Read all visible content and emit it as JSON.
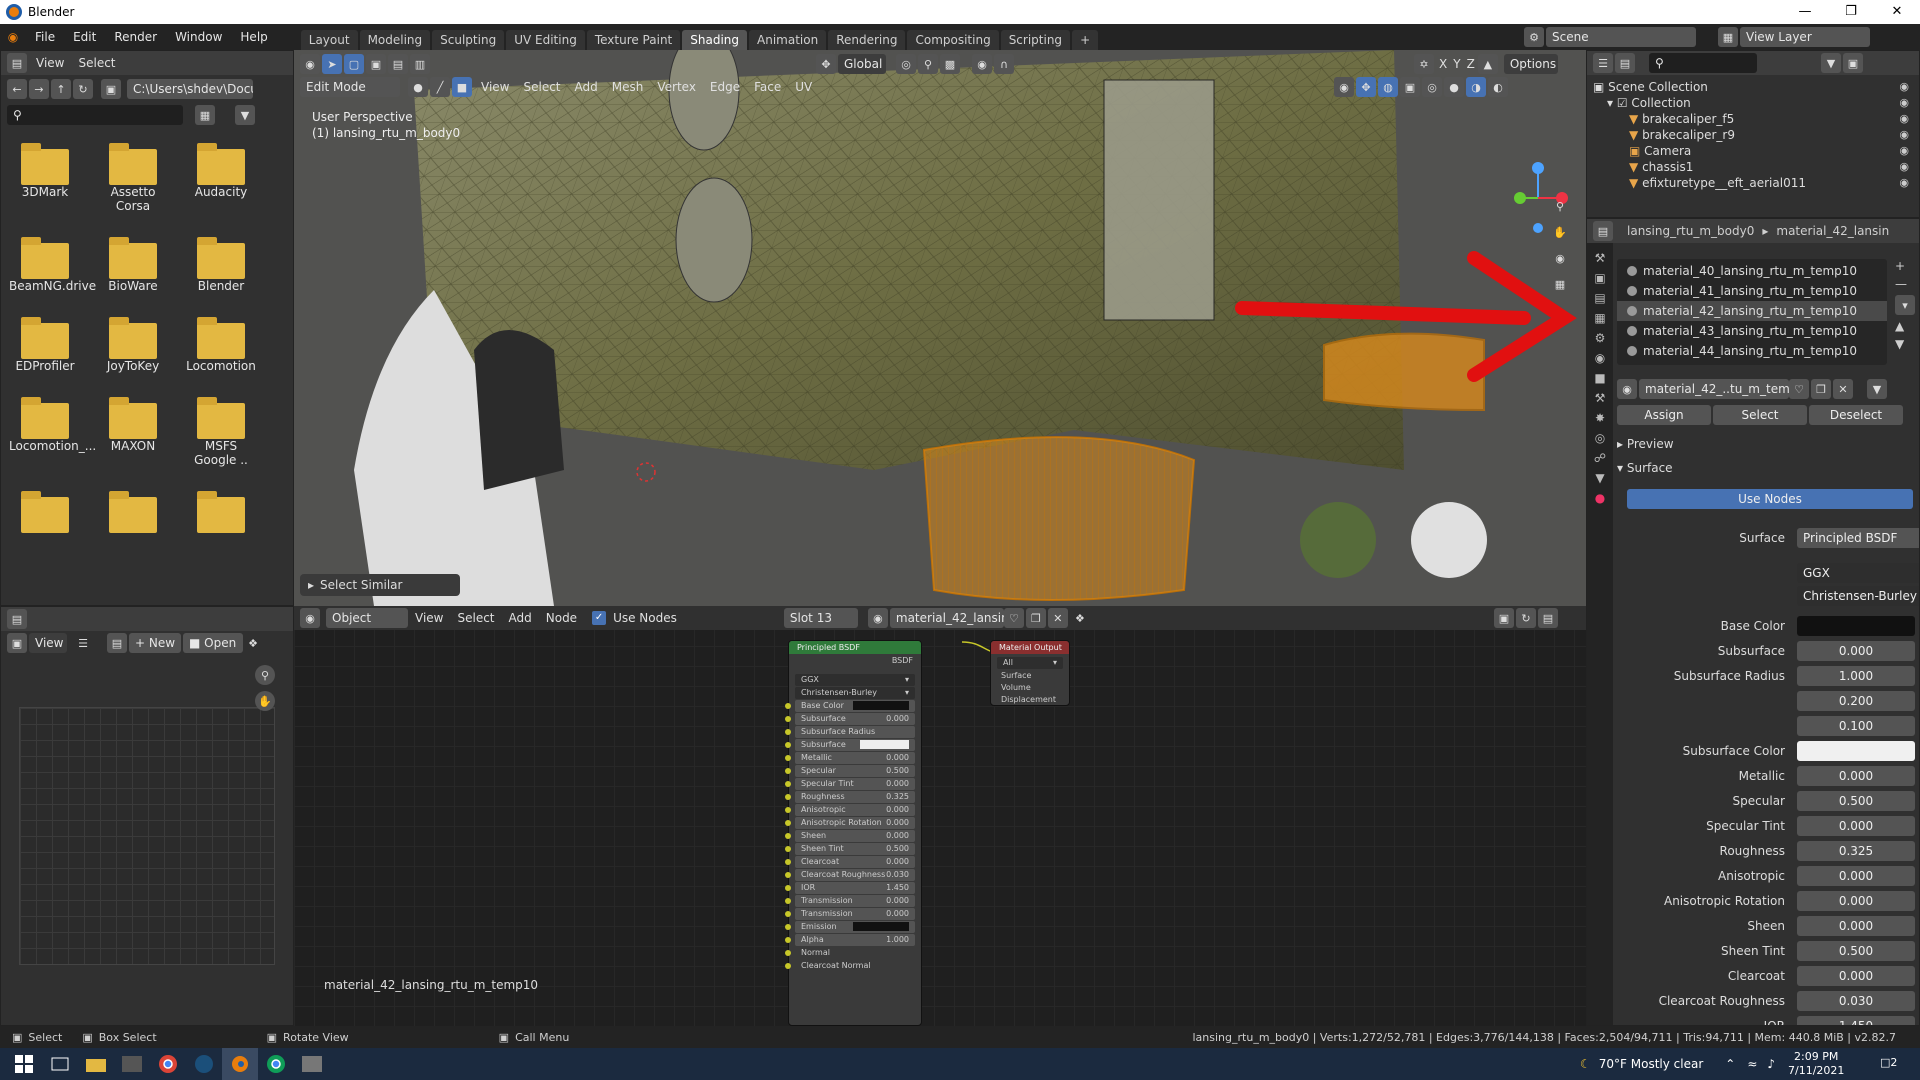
{
  "app": {
    "title": "Blender"
  },
  "menu": [
    "File",
    "Edit",
    "Render",
    "Window",
    "Help"
  ],
  "workspaces": [
    "Layout",
    "Modeling",
    "Sculpting",
    "UV Editing",
    "Texture Paint",
    "Shading",
    "Animation",
    "Rendering",
    "Compositing",
    "Scripting"
  ],
  "active_workspace": "Shading",
  "scene": {
    "label": "Scene",
    "view_layer": "View Layer"
  },
  "file_browser": {
    "menu": [
      "View",
      "Select"
    ],
    "path": "C:\\Users\\shdev\\Docu...",
    "folders": [
      "3DMark",
      "Assetto Corsa",
      "Audacity",
      "BeamNG.drive",
      "BioWare",
      "Blender",
      "EDProfiler",
      "JoyToKey",
      "Locomotion",
      "Locomotion_...",
      "MAXON",
      "MSFS Google ..",
      "",
      "",
      ""
    ]
  },
  "viewport": {
    "mode": "Edit Mode",
    "menu": [
      "View",
      "Select",
      "Add",
      "Mesh",
      "Vertex",
      "Edge",
      "Face",
      "UV"
    ],
    "transform": "Global",
    "overlay_title": "User Perspective",
    "overlay_object": "(1) lansing_rtu_m_body0",
    "operator_panel": "Select Similar",
    "options": "Options",
    "axes": [
      "X",
      "Y",
      "Z"
    ]
  },
  "image_editor": {
    "view": "View",
    "new": "New",
    "open": "Open"
  },
  "node_editor": {
    "object": "Object",
    "menu": [
      "View",
      "Select",
      "Add",
      "Node"
    ],
    "use_nodes": "Use Nodes",
    "slot": "Slot 13",
    "material": "material_42_lansing...",
    "material_label": "material_42_lansing_rtu_m_temp10",
    "bsdf": {
      "title": "Principled BSDF",
      "out": "BSDF",
      "dist": "GGX",
      "ss_method": "Christensen-Burley",
      "rows": [
        [
          "Base Color",
          ""
        ],
        [
          "Subsurface",
          "0.000"
        ],
        [
          "Subsurface Radius",
          ""
        ],
        [
          "Subsurface Color",
          ""
        ],
        [
          "Metallic",
          "0.000"
        ],
        [
          "Specular",
          "0.500"
        ],
        [
          "Specular Tint",
          "0.000"
        ],
        [
          "Roughness",
          "0.325"
        ],
        [
          "Anisotropic",
          "0.000"
        ],
        [
          "Anisotropic Rotation",
          "0.000"
        ],
        [
          "Sheen",
          "0.000"
        ],
        [
          "Sheen Tint",
          "0.500"
        ],
        [
          "Clearcoat",
          "0.000"
        ],
        [
          "Clearcoat Roughness",
          "0.030"
        ],
        [
          "IOR",
          "1.450"
        ],
        [
          "Transmission",
          "0.000"
        ],
        [
          "Transmission Roughness",
          "0.000"
        ],
        [
          "Emission",
          ""
        ],
        [
          "Alpha",
          "1.000"
        ],
        [
          "Normal",
          ""
        ],
        [
          "Clearcoat Normal",
          ""
        ]
      ]
    },
    "output": {
      "title": "Material Output",
      "target": "All",
      "rows": [
        "Surface",
        "Volume",
        "Displacement"
      ]
    }
  },
  "outliner": {
    "root": "Scene Collection",
    "collection": "Collection",
    "items": [
      "brakecaliper_f5",
      "brakecaliper_r9",
      "Camera",
      "chassis1",
      "efixturetype__eft_aerial011"
    ]
  },
  "properties": {
    "breadcrumb_object": "lansing_rtu_m_body0",
    "breadcrumb_material": "material_42_lansin",
    "materials": [
      "material_40_lansing_rtu_m_temp10",
      "material_41_lansing_rtu_m_temp10",
      "material_42_lansing_rtu_m_temp10",
      "material_43_lansing_rtu_m_temp10",
      "material_44_lansing_rtu_m_temp10"
    ],
    "selected_index": 2,
    "slot_name": "material_42_..tu_m_temp10",
    "assign": "Assign",
    "select": "Select",
    "deselect": "Deselect",
    "preview": "Preview",
    "surface_section": "Surface",
    "use_nodes": "Use Nodes",
    "surface_label": "Surface",
    "surface_value": "Principled BSDF",
    "dist": "GGX",
    "ss_method": "Christensen-Burley",
    "fields": [
      [
        "Base Color",
        ""
      ],
      [
        "Subsurface",
        "0.000"
      ],
      [
        "Subsurface Radius",
        "1.000"
      ],
      [
        "",
        "0.200"
      ],
      [
        "",
        "0.100"
      ],
      [
        "Subsurface Color",
        ""
      ],
      [
        "Metallic",
        "0.000"
      ],
      [
        "Specular",
        "0.500"
      ],
      [
        "Specular Tint",
        "0.000"
      ],
      [
        "Roughness",
        "0.325"
      ],
      [
        "Anisotropic",
        "0.000"
      ],
      [
        "Anisotropic Rotation",
        "0.000"
      ],
      [
        "Sheen",
        "0.000"
      ],
      [
        "Sheen Tint",
        "0.500"
      ],
      [
        "Clearcoat",
        "0.000"
      ],
      [
        "Clearcoat Roughness",
        "0.030"
      ],
      [
        "IOR",
        "1.450"
      ]
    ]
  },
  "statusbar": {
    "select": "Select",
    "box_select": "Box Select",
    "rotate": "Rotate View",
    "call_menu": "Call Menu",
    "stats": "lansing_rtu_m_body0 | Verts:1,272/52,781 | Edges:3,776/144,138 | Faces:2,504/94,711 | Tris:94,711 | Mem: 440.8 MiB | v2.82.7"
  },
  "taskbar": {
    "weather": "70°F  Mostly clear",
    "time": "2:09 PM",
    "date": "7/11/2021",
    "notif": "2"
  },
  "colors": {
    "accent": "#4772b3",
    "arrow": "#e11010",
    "mesh": "#6b6b3e",
    "orange": "#d98a1c"
  }
}
